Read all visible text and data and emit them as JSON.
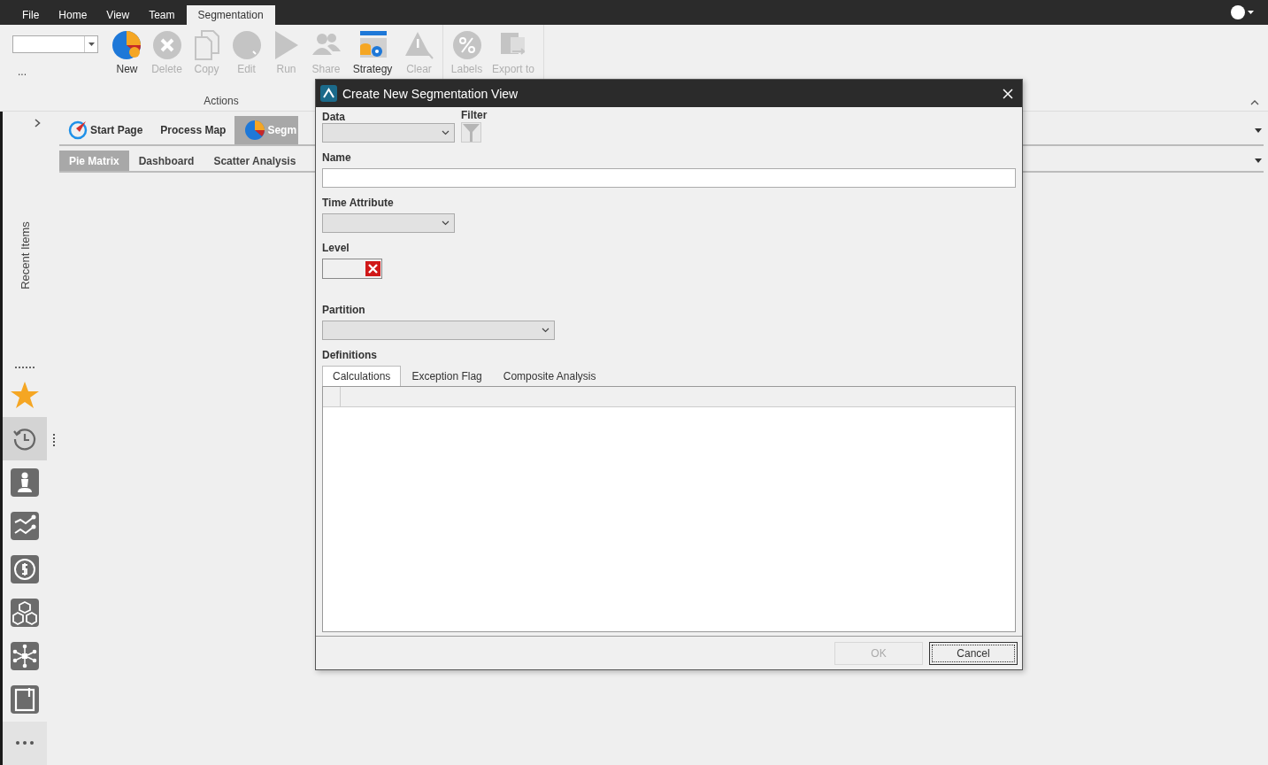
{
  "menu_tabs": [
    {
      "label": "File",
      "selected": false
    },
    {
      "label": "Home",
      "selected": false
    },
    {
      "label": "View",
      "selected": false
    },
    {
      "label": "Team",
      "selected": false
    },
    {
      "label": "Segmentation",
      "selected": true
    }
  ],
  "ribbon": {
    "combo_more": "...",
    "group_label": "Actions",
    "buttons": [
      {
        "label": "New",
        "disabled": false
      },
      {
        "label": "Delete",
        "disabled": true
      },
      {
        "label": "Copy",
        "disabled": true
      },
      {
        "label": "Edit",
        "disabled": true
      },
      {
        "label": "Run",
        "disabled": true
      },
      {
        "label": "Share",
        "disabled": true
      },
      {
        "label": "Strategy",
        "disabled": false
      },
      {
        "label": "Clear",
        "disabled": true
      }
    ],
    "buttons_2": [
      {
        "label": "Labels",
        "disabled": true
      },
      {
        "label": "Export to",
        "disabled": true
      }
    ]
  },
  "sidebar": {
    "label": "Recent Items",
    "items": [
      {
        "selected": false
      },
      {
        "selected": true
      },
      {
        "selected": false
      },
      {
        "selected": false
      },
      {
        "selected": false
      },
      {
        "selected": false
      },
      {
        "selected": false
      },
      {
        "selected": false
      }
    ]
  },
  "doc_tabs": [
    {
      "label": "Start Page",
      "selected": false
    },
    {
      "label": "Process Map",
      "selected": false
    },
    {
      "label": "Segm",
      "selected": true
    }
  ],
  "view_tabs": [
    {
      "label": "Pie Matrix",
      "selected": true
    },
    {
      "label": "Dashboard",
      "selected": false
    },
    {
      "label": "Scatter Analysis",
      "selected": false
    }
  ],
  "dialog": {
    "title": "Create New Segmentation View",
    "data_label": "Data",
    "filter_label": "Filter",
    "name_label": "Name",
    "time_label": "Time Attribute",
    "level_label": "Level",
    "partition_label": "Partition",
    "definitions_label": "Definitions",
    "def_tabs": [
      {
        "label": "Calculations",
        "selected": true
      },
      {
        "label": "Exception Flag",
        "selected": false
      },
      {
        "label": "Composite Analysis",
        "selected": false
      }
    ],
    "buttons": [
      {
        "label": "OK",
        "disabled": true,
        "focused": false
      },
      {
        "label": "Cancel",
        "disabled": false,
        "focused": true
      }
    ]
  }
}
